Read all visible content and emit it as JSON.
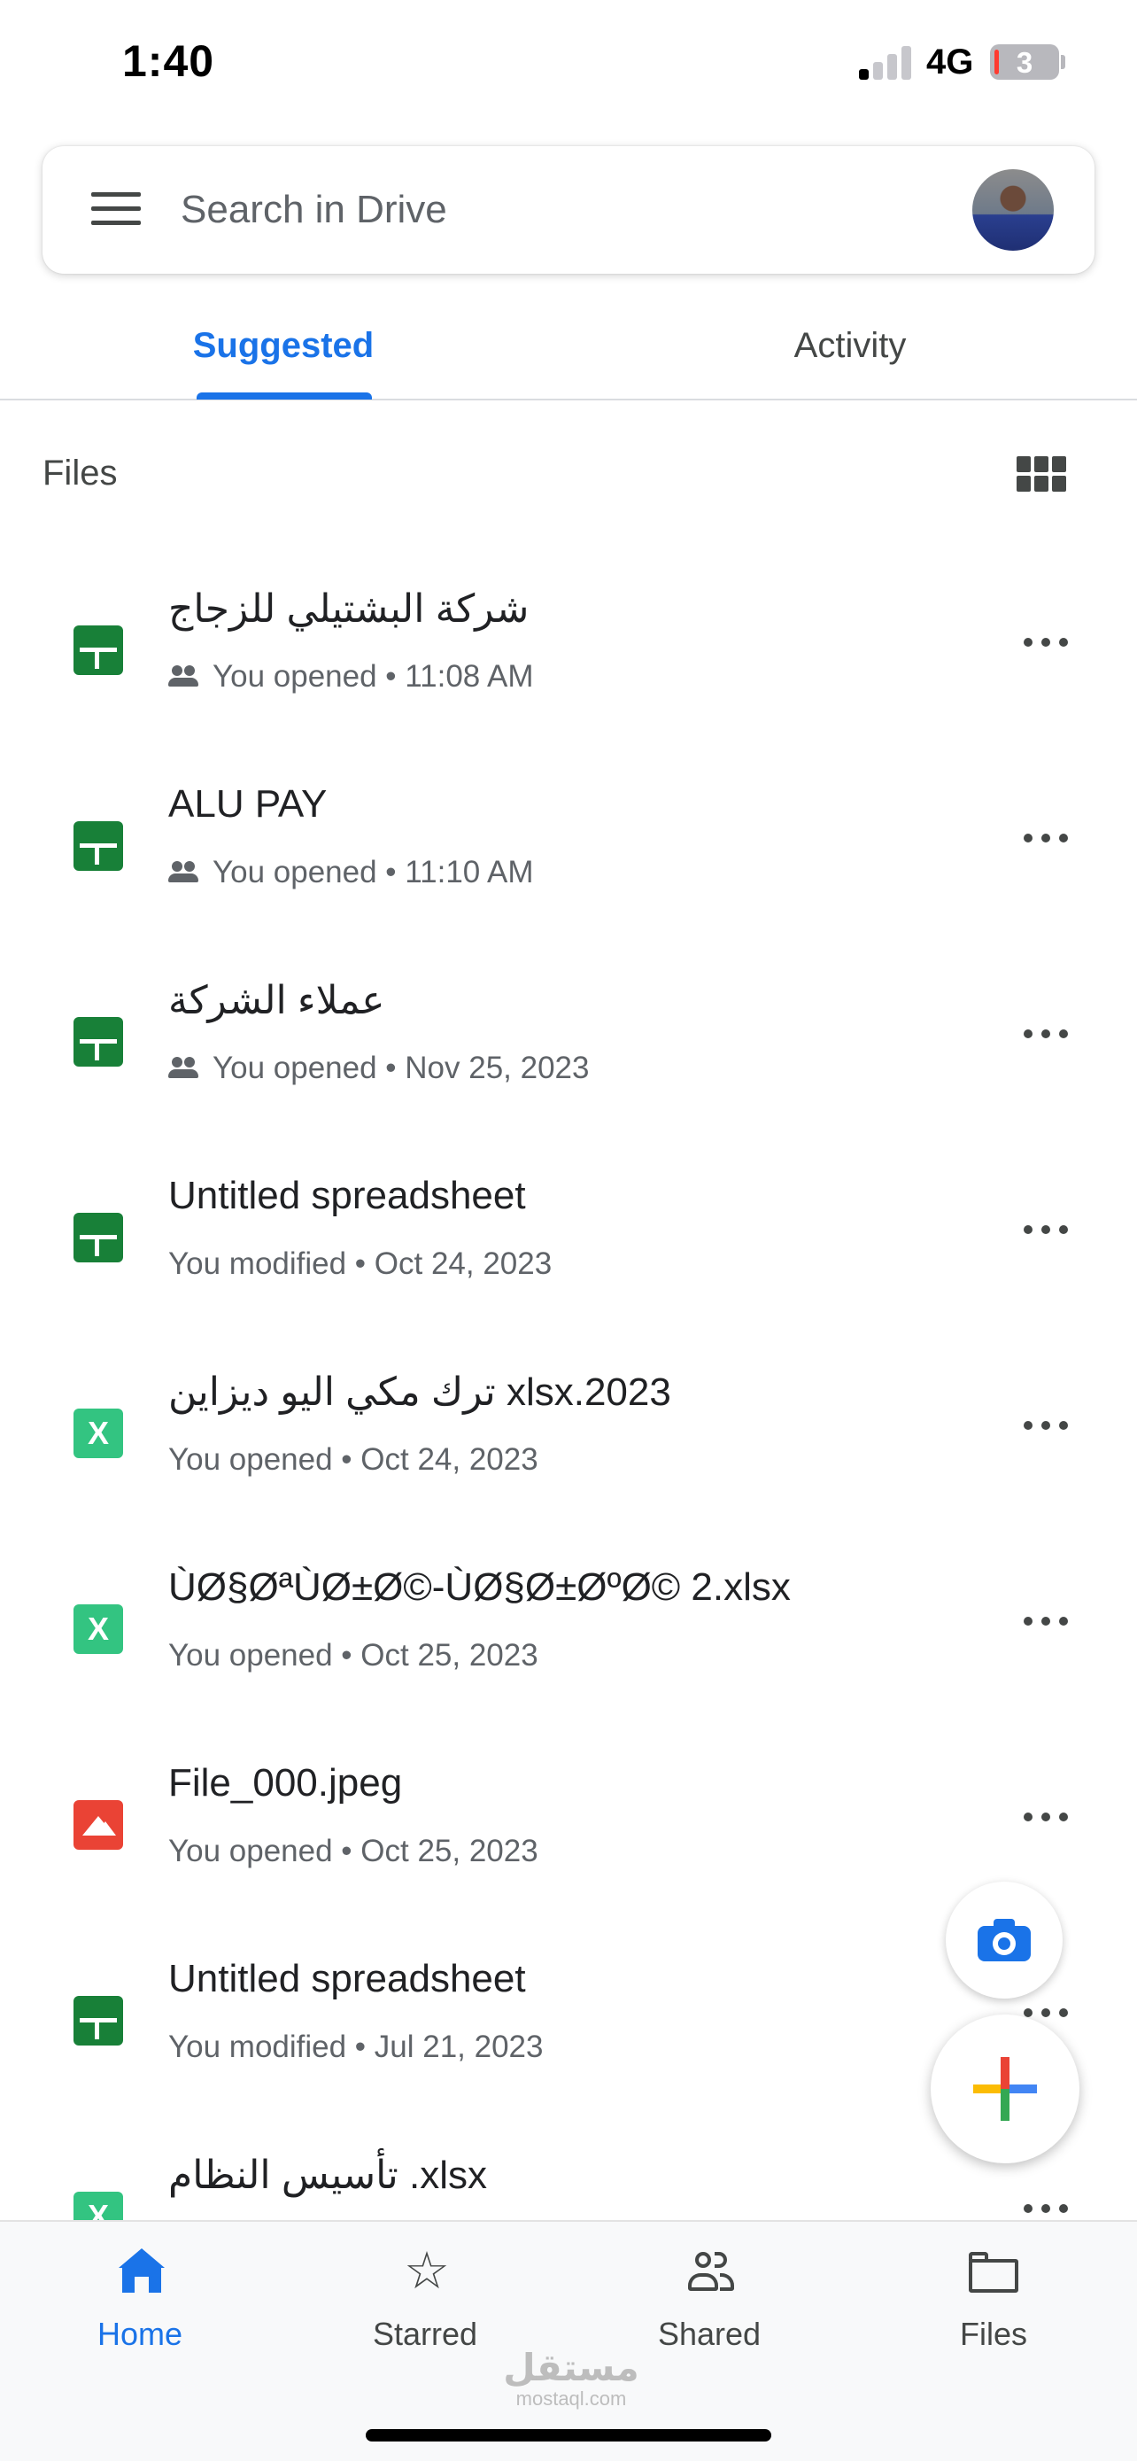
{
  "status_bar": {
    "time": "1:40",
    "network": "4G",
    "battery_percent": "3"
  },
  "search": {
    "placeholder": "Search in Drive"
  },
  "tabs": [
    {
      "label": "Suggested",
      "active": true
    },
    {
      "label": "Activity",
      "active": false
    }
  ],
  "files_section": {
    "title": "Files"
  },
  "files": [
    {
      "name": "شركة البشتيلي للزجاج",
      "meta": "You opened • 11:08 AM",
      "type": "sheets",
      "shared": true
    },
    {
      "name": "ALU PAY",
      "meta": "You opened • 11:10 AM",
      "type": "sheets",
      "shared": true
    },
    {
      "name": "عملاء الشركة",
      "meta": "You opened • Nov 25, 2023",
      "type": "sheets",
      "shared": true
    },
    {
      "name": "Untitled spreadsheet",
      "meta": "You modified • Oct 24, 2023",
      "type": "sheets",
      "shared": false
    },
    {
      "name": "ترك مكي اليو ديزاين xlsx.2023",
      "meta": "You opened • Oct 24, 2023",
      "type": "excel",
      "shared": false
    },
    {
      "name": "ÙØ§ØªÙØ±Ø©-ÙØ§Ø±ØºØ© 2.xlsx",
      "meta": "You opened • Oct 25, 2023",
      "type": "excel",
      "shared": false
    },
    {
      "name": "File_000.jpeg",
      "meta": "You opened • Oct 25, 2023",
      "type": "image",
      "shared": false
    },
    {
      "name": "Untitled spreadsheet",
      "meta": "You modified • Jul 21, 2023",
      "type": "sheets",
      "shared": false
    },
    {
      "name": "تأسيس النظام .xlsx",
      "meta": "",
      "type": "excel",
      "shared": false
    }
  ],
  "excel_icon_letter": "X",
  "nav": {
    "home": "Home",
    "starred": "Starred",
    "shared": "Shared",
    "files": "Files"
  },
  "watermark": {
    "arabic": "مستقل",
    "latin": "mostaql.com"
  },
  "colors": {
    "accent": "#1a73e8",
    "sheets": "#188038",
    "excel": "#33c481",
    "image": "#ea4335"
  },
  "icons": {
    "menu": "menu-icon",
    "grid_view": "grid-view-icon",
    "more": "more-horizontal-icon",
    "camera": "camera-icon",
    "new": "plus-icon",
    "home": "home-icon",
    "starred": "star-icon",
    "shared": "people-icon",
    "files": "folder-icon"
  }
}
